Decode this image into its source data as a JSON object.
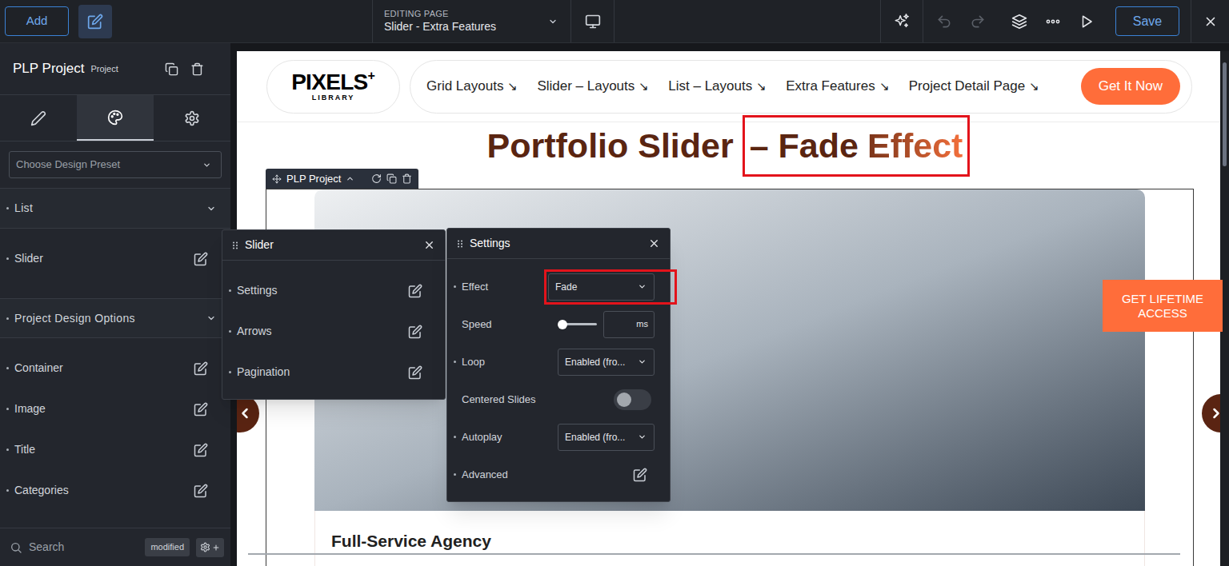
{
  "topbar": {
    "add_button": "Add",
    "editing_label": "EDITING PAGE",
    "page_title": "Slider - Extra Features",
    "undo_disabled": true,
    "redo_disabled": true,
    "save_button": "Save"
  },
  "left_panel": {
    "title": "PLP Project",
    "badge": "Project",
    "tabs": [
      {
        "kind": "content",
        "selected": false
      },
      {
        "kind": "style",
        "selected": true
      },
      {
        "kind": "settings",
        "selected": false
      }
    ],
    "preset_placeholder": "Choose Design Preset",
    "sections": [
      {
        "label": "List",
        "modified": true,
        "expanded": true,
        "items": [
          {
            "label": "Slider",
            "modified": true
          }
        ]
      },
      {
        "label": "Project Design Options",
        "modified": true,
        "expanded": true,
        "items": [
          {
            "label": "Container",
            "modified": true
          },
          {
            "label": "Image",
            "modified": true
          },
          {
            "label": "Title",
            "modified": true
          },
          {
            "label": "Categories",
            "modified": true
          }
        ]
      }
    ],
    "search": {
      "placeholder": "Search"
    },
    "modified_badge": "modified"
  },
  "canvas": {
    "logo": {
      "main": "PIXELS",
      "plus": "+",
      "sub": "LIBRARY"
    },
    "nav": [
      {
        "label": "Grid Layouts",
        "arrow": "↘"
      },
      {
        "label": "Slider – Layouts",
        "arrow": "↘"
      },
      {
        "label": "List – Layouts",
        "arrow": "↘"
      },
      {
        "label": "Extra Features",
        "arrow": "↘"
      },
      {
        "label": "Project Detail Page",
        "arrow": "↘"
      }
    ],
    "cta": "Get It Now",
    "heading": {
      "lead": "Portfolio Slider",
      "highlight": "– Fade",
      "accent": "Effect"
    },
    "element_label": "PLP Project",
    "card_title": "Full-Service Agency",
    "side_badge": "GET LIFETIME ACCESS"
  },
  "popups": {
    "slider": {
      "title": "Slider",
      "rows": [
        {
          "label": "Settings",
          "modified": true
        },
        {
          "label": "Arrows",
          "modified": true
        },
        {
          "label": "Pagination",
          "modified": true
        }
      ]
    },
    "settings": {
      "title": "Settings",
      "rows": [
        {
          "label": "Effect",
          "kind": "select",
          "value": "Fade",
          "modified": true,
          "highlighted": true
        },
        {
          "label": "Speed",
          "kind": "range",
          "level": 0,
          "unit": "ms",
          "modified": false
        },
        {
          "label": "Loop",
          "kind": "select",
          "value": "Enabled (fro...",
          "modified": true
        },
        {
          "label": "Centered Slides",
          "kind": "toggle",
          "on": false,
          "modified": false
        },
        {
          "label": "Autoplay",
          "kind": "select",
          "value": "Enabled (fro...",
          "modified": true
        },
        {
          "label": "Advanced",
          "kind": "link",
          "modified": true
        }
      ]
    }
  }
}
